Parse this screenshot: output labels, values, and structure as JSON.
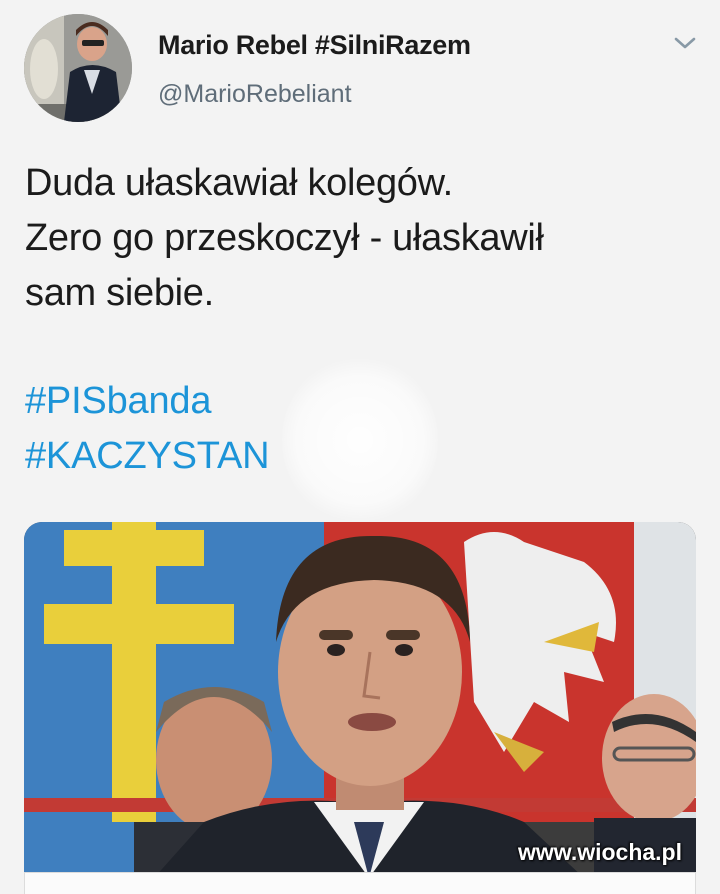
{
  "author": {
    "display_name": "Mario Rebel #SilniRazem",
    "handle": "@MarioRebeliant",
    "avatar_icon": "user-avatar-photo"
  },
  "menu": {
    "icon": "chevron-down-icon"
  },
  "tweet": {
    "lines": [
      "Duda ułaskawiał kolegów.",
      "Zero go przeskoczył - ułaskawił",
      "sam siebie."
    ],
    "hashtags": [
      "#PISbanda",
      "#KACZYSTAN"
    ]
  },
  "media": {
    "watermark": "www.wiocha.pl"
  },
  "colors": {
    "hashtag": "#1c94d8",
    "text": "#1b1b1b",
    "handle": "#5f6d79",
    "background": "#f3f3f3"
  }
}
